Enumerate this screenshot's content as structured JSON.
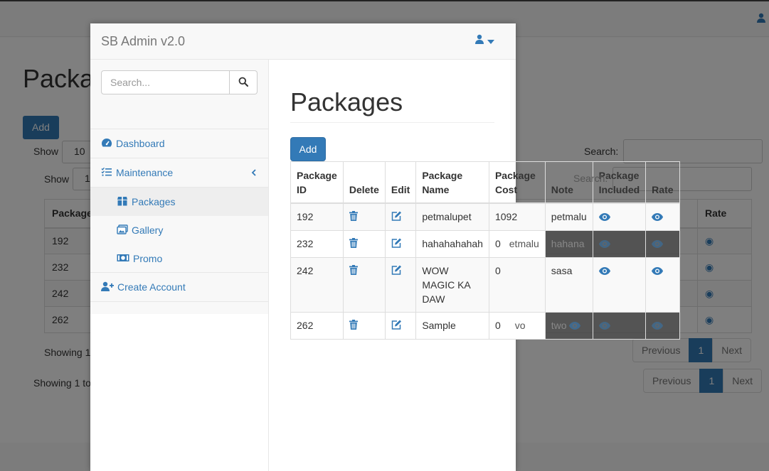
{
  "background": {
    "title": "Packa",
    "add_label": "Add",
    "show_label": "Show",
    "show_value_1": "10",
    "show_value_2": "1",
    "search_label": "Search:",
    "table": {
      "headers": [
        "Package",
        "Rate"
      ],
      "rows": [
        "192",
        "232",
        "242",
        "262"
      ]
    },
    "showing_1": "Showing 1",
    "showing_2": "Showing 1 to",
    "pagination": {
      "previous": "Previous",
      "page": "1",
      "next": "Next"
    }
  },
  "app": {
    "brand": "SB Admin v2.0"
  },
  "sidebar": {
    "search_placeholder": "Search...",
    "items": [
      {
        "label": "Dashboard"
      },
      {
        "label": "Maintenance"
      },
      {
        "label": "Packages"
      },
      {
        "label": "Gallery"
      },
      {
        "label": "Promo"
      },
      {
        "label": "Create Account"
      }
    ]
  },
  "main": {
    "title": "Packages",
    "add_label": "Add",
    "search_label": "Search:",
    "table": {
      "headers": [
        [
          "Package",
          "ID"
        ],
        [
          "Delete"
        ],
        [
          "Edit"
        ],
        [
          "Package",
          "Name"
        ],
        [
          "Package",
          "Cost"
        ],
        [
          "Note"
        ],
        [
          "Package",
          "Included"
        ],
        [
          "Rate"
        ]
      ],
      "rows": [
        {
          "id": "192",
          "name": [
            "petmalupet"
          ],
          "cost": "1092",
          "note": "petmalu"
        },
        {
          "id": "232",
          "name": [
            "hahahahahah"
          ],
          "cost": "0",
          "note": "hahana",
          "overflow": "etmalu"
        },
        {
          "id": "242",
          "name": [
            "WOW",
            "MAGIC KA",
            "DAW"
          ],
          "cost": "0",
          "note": "sasa"
        },
        {
          "id": "262",
          "name": [
            "Sample"
          ],
          "cost": "0",
          "note": "two",
          "overflow": "vo"
        }
      ]
    }
  },
  "colors": {
    "primary": "#337ab7",
    "navbar": "#f8f8f8",
    "border": "#ddd"
  },
  "icons": {
    "user": "user-icon",
    "caret": "caret-down-icon",
    "search": "search-icon",
    "dashboard": "tachometer-icon",
    "maintenance": "tasks-icon",
    "packages": "box-icon",
    "gallery": "images-icon",
    "promo": "money-bill-icon",
    "create_account": "user-plus-icon",
    "delete": "trash-icon",
    "edit": "edit-icon",
    "view": "eye-icon",
    "collapse": "chevron-left-icon"
  }
}
